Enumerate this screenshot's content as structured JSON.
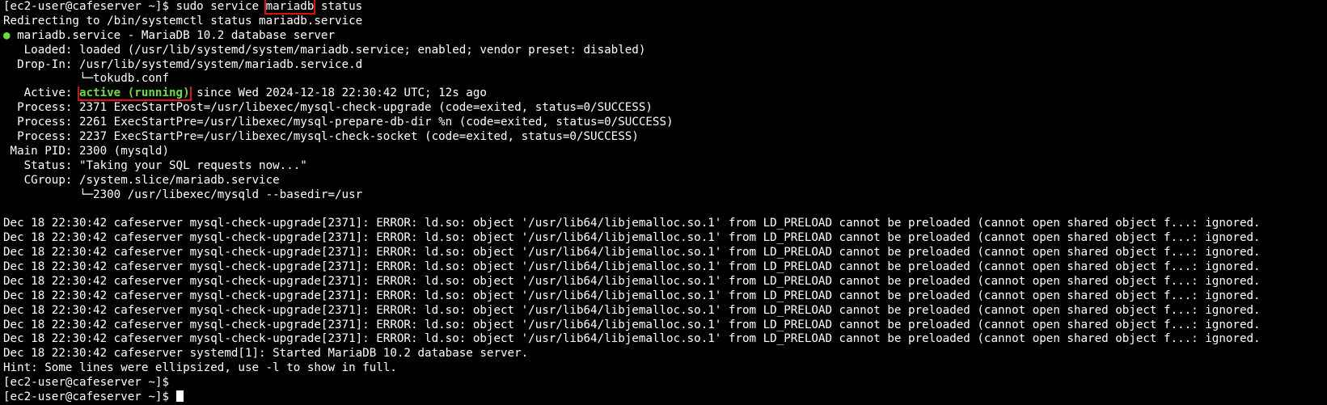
{
  "colors": {
    "background": "#000000",
    "text": "#ffffff",
    "active": "#66e03a",
    "highlight_box": "#e01010"
  },
  "cmd": {
    "prompt": "[ec2-user@cafeserver ~]$ ",
    "before": "sudo service ",
    "service": "mariadb",
    "after": " status"
  },
  "redirect": "Redirecting to /bin/systemctl status mariadb.service",
  "unit": {
    "bullet": "●",
    "title": " mariadb.service - MariaDB 10.2 database server"
  },
  "loaded": "   Loaded: loaded (/usr/lib/systemd/system/mariadb.service; enabled; vendor preset: disabled)",
  "dropin": "  Drop-In: /usr/lib/systemd/system/mariadb.service.d",
  "dropin_file": "           └─tokudb.conf",
  "active": {
    "label": "   Active: ",
    "state": "active (running)",
    "since": " since Wed 2024-12-18 22:30:42 UTC; 12s ago"
  },
  "processes": [
    "  Process: 2371 ExecStartPost=/usr/libexec/mysql-check-upgrade (code=exited, status=0/SUCCESS)",
    "  Process: 2261 ExecStartPre=/usr/libexec/mysql-prepare-db-dir %n (code=exited, status=0/SUCCESS)",
    "  Process: 2237 ExecStartPre=/usr/libexec/mysql-check-socket (code=exited, status=0/SUCCESS)"
  ],
  "main_pid": " Main PID: 2300 (mysqld)",
  "status": "   Status: \"Taking your SQL requests now...\"",
  "cgroup": "   CGroup: /system.slice/mariadb.service",
  "cgroup_child": "           └─2300 /usr/libexec/mysqld --basedir=/usr",
  "log": [
    "Dec 18 22:30:42 cafeserver mysql-check-upgrade[2371]: ERROR: ld.so: object '/usr/lib64/libjemalloc.so.1' from LD_PRELOAD cannot be preloaded (cannot open shared object f...: ignored.",
    "Dec 18 22:30:42 cafeserver mysql-check-upgrade[2371]: ERROR: ld.so: object '/usr/lib64/libjemalloc.so.1' from LD_PRELOAD cannot be preloaded (cannot open shared object f...: ignored.",
    "Dec 18 22:30:42 cafeserver mysql-check-upgrade[2371]: ERROR: ld.so: object '/usr/lib64/libjemalloc.so.1' from LD_PRELOAD cannot be preloaded (cannot open shared object f...: ignored.",
    "Dec 18 22:30:42 cafeserver mysql-check-upgrade[2371]: ERROR: ld.so: object '/usr/lib64/libjemalloc.so.1' from LD_PRELOAD cannot be preloaded (cannot open shared object f...: ignored.",
    "Dec 18 22:30:42 cafeserver mysql-check-upgrade[2371]: ERROR: ld.so: object '/usr/lib64/libjemalloc.so.1' from LD_PRELOAD cannot be preloaded (cannot open shared object f...: ignored.",
    "Dec 18 22:30:42 cafeserver mysql-check-upgrade[2371]: ERROR: ld.so: object '/usr/lib64/libjemalloc.so.1' from LD_PRELOAD cannot be preloaded (cannot open shared object f...: ignored.",
    "Dec 18 22:30:42 cafeserver mysql-check-upgrade[2371]: ERROR: ld.so: object '/usr/lib64/libjemalloc.so.1' from LD_PRELOAD cannot be preloaded (cannot open shared object f...: ignored.",
    "Dec 18 22:30:42 cafeserver mysql-check-upgrade[2371]: ERROR: ld.so: object '/usr/lib64/libjemalloc.so.1' from LD_PRELOAD cannot be preloaded (cannot open shared object f...: ignored.",
    "Dec 18 22:30:42 cafeserver mysql-check-upgrade[2371]: ERROR: ld.so: object '/usr/lib64/libjemalloc.so.1' from LD_PRELOAD cannot be preloaded (cannot open shared object f...: ignored.",
    "Dec 18 22:30:42 cafeserver systemd[1]: Started MariaDB 10.2 database server."
  ],
  "hint": "Hint: Some lines were ellipsized, use -l to show in full.",
  "prompts": [
    "[ec2-user@cafeserver ~]$",
    "[ec2-user@cafeserver ~]$ "
  ]
}
